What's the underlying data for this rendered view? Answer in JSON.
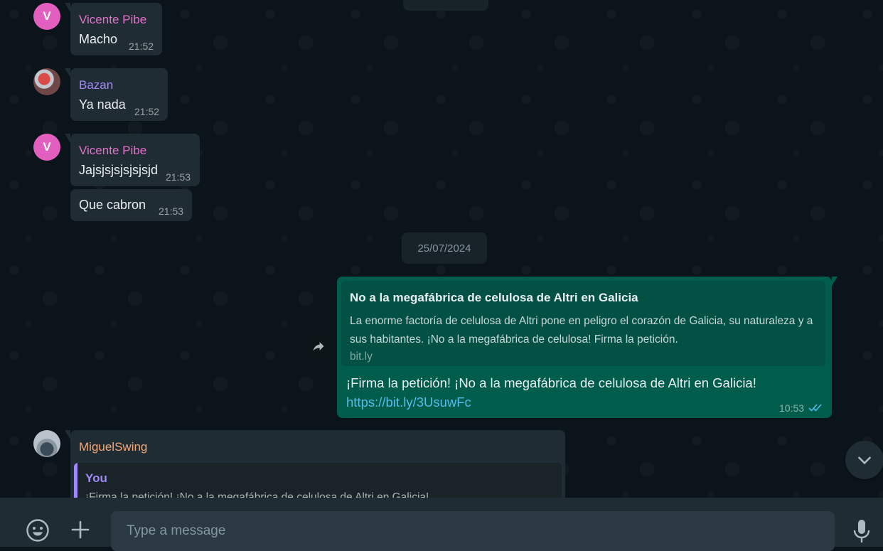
{
  "messages": [
    {
      "sender": "Vicente Pibe",
      "avatar_letter": "V",
      "text": "Macho",
      "time": "21:52"
    },
    {
      "sender": "Bazan",
      "text": "Ya nada",
      "time": "21:52"
    },
    {
      "sender": "Vicente Pibe",
      "avatar_letter": "V",
      "text": "Jajsjsjsjsjsjsjd",
      "time": "21:53"
    },
    {
      "text": "Que cabron",
      "time": "21:53"
    }
  ],
  "date_separator": "25/07/2024",
  "outgoing": {
    "preview_title": "No a la megafábrica de celulosa de Altri en Galicia",
    "preview_description": "La enorme factoría de celulosa de Altri pone en peligro el corazón de Galicia, su naturaleza y a sus habitantes. ¡No a la megafábrica de celulosa! Firma la petición.",
    "preview_host": "bit.ly",
    "text": "¡Firma la petición! ¡No a la megafábrica de celulosa de Altri en Galicia!",
    "link": "https://bit.ly/3UsuwFc",
    "time": "10:53",
    "status": "read"
  },
  "reply_message": {
    "sender": "MiguelSwing",
    "quoted_author": "You",
    "quoted_text": "¡Firma la petición! ¡No a la megafábrica de celulosa de Altri en Galicia!"
  },
  "composer": {
    "placeholder": "Type a message"
  },
  "colors": {
    "background": "#0b141a",
    "incoming_bubble": "#202c33",
    "outgoing_bubble": "#005c4b",
    "link": "#53bdeb",
    "read_ticks": "#53bdeb"
  },
  "icons": [
    "forward-icon",
    "chevron-down-icon",
    "emoji-icon",
    "plus-icon",
    "microphone-icon",
    "double-check-icon"
  ]
}
